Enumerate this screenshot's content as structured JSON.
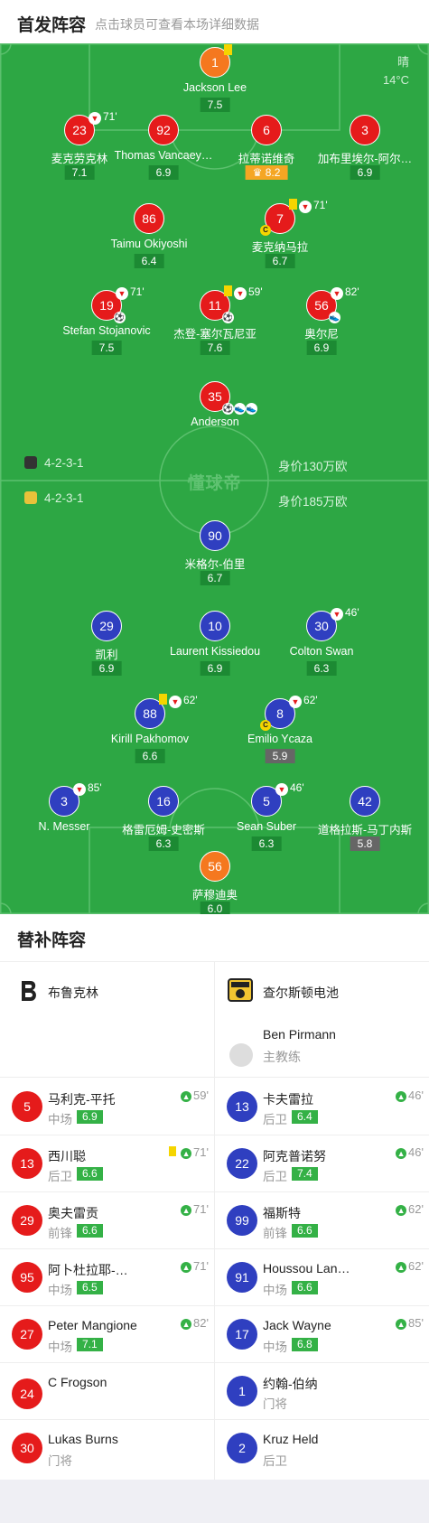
{
  "header": {
    "title": "首发阵容",
    "subtitle": "点击球员可查看本场详细数据"
  },
  "weather": {
    "condition": "晴",
    "temp": "14°C"
  },
  "pitch_logo": "懂球帝",
  "home_team": {
    "formation": "4-2-3-1",
    "value": "身价130万欧"
  },
  "away_team": {
    "formation": "4-2-3-1",
    "value": "身价185万欧"
  },
  "home_players": [
    {
      "num": "1",
      "name": "Jackson Lee",
      "rating": "7.5"
    },
    {
      "num": "23",
      "name": "麦克劳克林",
      "rating": "7.1",
      "sub_min": "71'"
    },
    {
      "num": "92",
      "name": "Thomas Vancaey…",
      "rating": "6.9"
    },
    {
      "num": "6",
      "name": "拉蒂诺维奇",
      "rating": "8.2"
    },
    {
      "num": "3",
      "name": "加布里埃尔-阿尔…",
      "rating": "6.9"
    },
    {
      "num": "86",
      "name": "Taimu Okiyoshi",
      "rating": "6.4"
    },
    {
      "num": "7",
      "name": "麦克纳马拉",
      "rating": "6.7",
      "sub_min": "71'",
      "captain": "C"
    },
    {
      "num": "19",
      "name": "Stefan Stojanovic",
      "rating": "7.5",
      "sub_min": "71'"
    },
    {
      "num": "11",
      "name": "杰登-塞尔瓦尼亚",
      "rating": "7.6",
      "sub_min": "59'"
    },
    {
      "num": "56",
      "name": "奥尔尼",
      "rating": "6.9",
      "sub_min": "82'"
    },
    {
      "num": "35",
      "name": "Anderson",
      "rating": ""
    }
  ],
  "away_players": [
    {
      "num": "90",
      "name": "米格尔-伯里",
      "rating": "6.7"
    },
    {
      "num": "29",
      "name": "凯利",
      "rating": "6.9"
    },
    {
      "num": "10",
      "name": "Laurent Kissiedou",
      "rating": "6.9"
    },
    {
      "num": "30",
      "name": "Colton Swan",
      "rating": "6.3",
      "sub_min": "46'"
    },
    {
      "num": "88",
      "name": "Kirill Pakhomov",
      "rating": "6.6",
      "sub_min": "62'"
    },
    {
      "num": "8",
      "name": "Emilio Ycaza",
      "rating": "5.9",
      "sub_min": "62'",
      "captain": "C"
    },
    {
      "num": "3",
      "name": "N. Messer",
      "rating": "",
      "sub_min": "85'"
    },
    {
      "num": "16",
      "name": "格雷厄姆-史密斯",
      "rating": "6.3"
    },
    {
      "num": "5",
      "name": "Sean Suber",
      "rating": "6.3",
      "sub_min": "46'"
    },
    {
      "num": "42",
      "name": "道格拉斯-马丁内斯",
      "rating": "5.8"
    },
    {
      "num": "56",
      "name": "萨穆迪奥",
      "rating": "6.0"
    }
  ],
  "subs": {
    "title": "替补阵容",
    "home_name": "布鲁克林",
    "away_name": "查尔斯顿电池",
    "away_coach": {
      "name": "Ben Pirmann",
      "role": "主教练"
    },
    "home_list": [
      {
        "num": "5",
        "name": "马利克-平托",
        "pos": "中场",
        "rating": "6.9",
        "min": "59'"
      },
      {
        "num": "13",
        "name": "西川聪",
        "pos": "后卫",
        "rating": "6.6",
        "min": "71'"
      },
      {
        "num": "29",
        "name": "奥夫雷贡",
        "pos": "前锋",
        "rating": "6.6",
        "min": "71'"
      },
      {
        "num": "95",
        "name": "阿卜杜拉耶-…",
        "pos": "中场",
        "rating": "6.5",
        "min": "71'"
      },
      {
        "num": "27",
        "name": "Peter Mangione",
        "pos": "中场",
        "rating": "7.1",
        "min": "82'"
      },
      {
        "num": "24",
        "name": "C Frogson",
        "pos": "",
        "rating": "",
        "min": ""
      },
      {
        "num": "30",
        "name": "Lukas Burns",
        "pos": "门将",
        "rating": "",
        "min": ""
      }
    ],
    "away_list": [
      {
        "num": "13",
        "name": "卡夫雷拉",
        "pos": "后卫",
        "rating": "6.4",
        "min": "46'"
      },
      {
        "num": "22",
        "name": "阿克普诺努",
        "pos": "后卫",
        "rating": "7.4",
        "min": "46'"
      },
      {
        "num": "99",
        "name": "福斯特",
        "pos": "前锋",
        "rating": "6.6",
        "min": "62'"
      },
      {
        "num": "91",
        "name": "Houssou Lan…",
        "pos": "中场",
        "rating": "6.6",
        "min": "62'"
      },
      {
        "num": "17",
        "name": "Jack Wayne",
        "pos": "中场",
        "rating": "6.8",
        "min": "85'"
      },
      {
        "num": "1",
        "name": "约翰-伯纳",
        "pos": "门将",
        "rating": "",
        "min": ""
      },
      {
        "num": "2",
        "name": "Kruz Held",
        "pos": "后卫",
        "rating": "",
        "min": ""
      }
    ]
  }
}
